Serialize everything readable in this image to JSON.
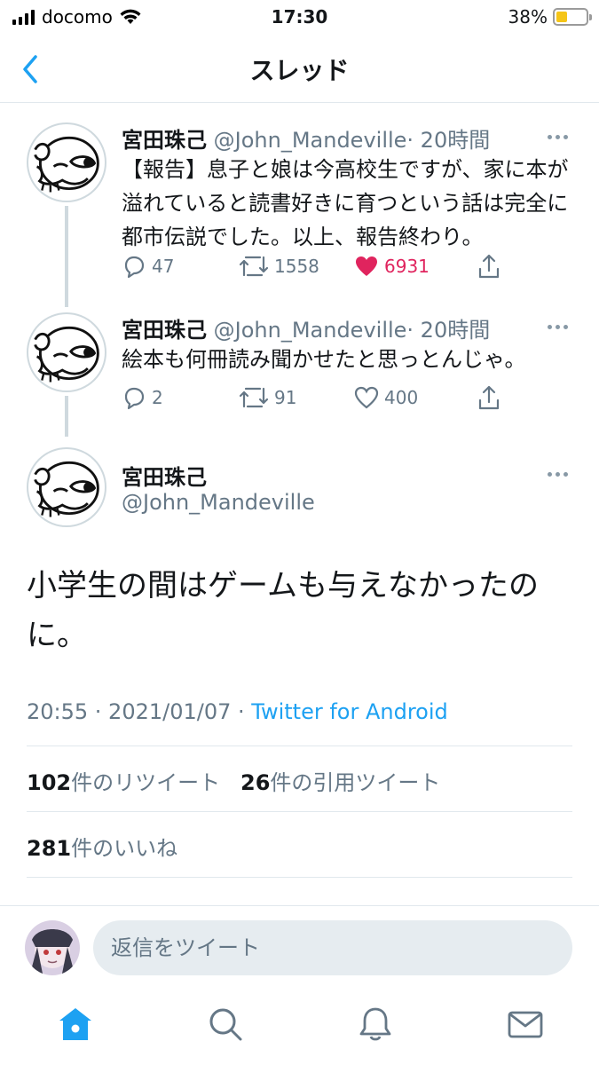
{
  "status_bar": {
    "carrier": "docomo",
    "time": "17:30",
    "battery": "38%",
    "battery_level": 0.38
  },
  "header": {
    "title": "スレッド"
  },
  "thread": [
    {
      "name": "宮田珠己",
      "handle": "@John_Mandeville",
      "time": "· 20時間",
      "text": "【報告】息子と娘は今高校生ですが、家に本が溢れていると読書好きに育つという話は完全に都市伝説でした。以上、報告終わり。",
      "replies": "47",
      "retweets": "1558",
      "likes": "6931",
      "liked": true
    },
    {
      "name": "宮田珠己",
      "handle": "@John_Mandeville",
      "time": "· 20時間",
      "text": "絵本も何冊読み聞かせたと思っとんじゃ。",
      "replies": "2",
      "retweets": "91",
      "likes": "400",
      "liked": false
    }
  ],
  "main_tweet": {
    "name": "宮田珠己",
    "handle": "@John_Mandeville",
    "text": "小学生の間はゲームも与えなかったのに。",
    "time": "20:55 · 2021/01/07 · ",
    "source": "Twitter for Android",
    "retweet_count": "102",
    "retweet_label": "件のリツイート",
    "quote_count": "26",
    "quote_label": "件の引用ツイート",
    "like_count": "281",
    "like_label": "件のいいね"
  },
  "reply": {
    "placeholder": "返信をツイート"
  },
  "colors": {
    "accent": "#1da1f2",
    "like": "#e0245e",
    "muted": "#657786",
    "battery": "#f5c518"
  }
}
